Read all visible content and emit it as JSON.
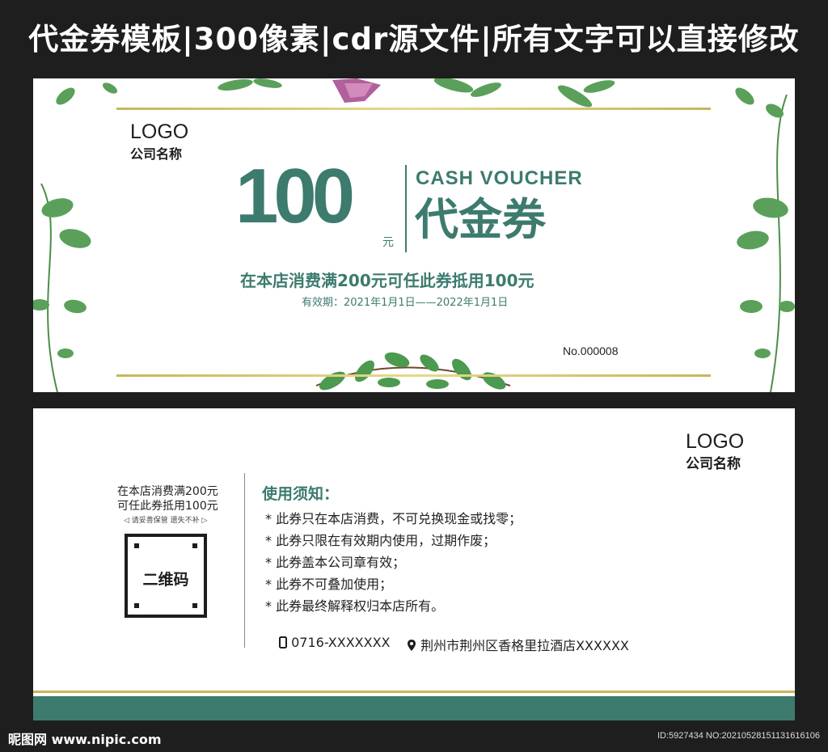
{
  "banner": {
    "text": "代金券模板|300像素|cdr源文件|所有文字可以直接修改"
  },
  "front": {
    "logo": "LOGO",
    "company": "公司名称",
    "amount": "100",
    "unit": "元",
    "cash_voucher": "CASH VOUCHER",
    "voucher_title": "代金券",
    "offer": "在本店消费满200元可任此券抵用100元",
    "validity": "有效期：2021年1月1日——2022年1月1日",
    "serial": "No.000008"
  },
  "back": {
    "logo": "LOGO",
    "company": "公司名称",
    "left_line1": "在本店消费满200元",
    "left_line2": "可任此券抵用100元",
    "keep_note": "◁ 请妥善保管  遗失不补 ▷",
    "qr_label": "二维码",
    "notice_title": "使用须知：",
    "notice_items": [
      "*  此券只在本店消费，不可兑换现金或找零；",
      "*  此券只限在有效期内使用，过期作废；",
      "*  此券盖本公司章有效；",
      "*  此券不可叠加使用；",
      "*  此券最终解释权归本店所有。"
    ],
    "phone": "0716-XXXXXXX",
    "address": "荆州市荆州区香格里拉酒店XXXXXX"
  },
  "footer": {
    "watermark": "昵图网 www.nipic.com",
    "id_text": "ID:5927434 NO:20210528151131616106"
  },
  "colors": {
    "brand_green": "#3c7b6e",
    "gold": "#c7b65a",
    "background": "#1e1e1e",
    "leaf": "#5aa05a"
  },
  "icons": {
    "phone": "phone-icon",
    "location": "location-pin-icon"
  }
}
